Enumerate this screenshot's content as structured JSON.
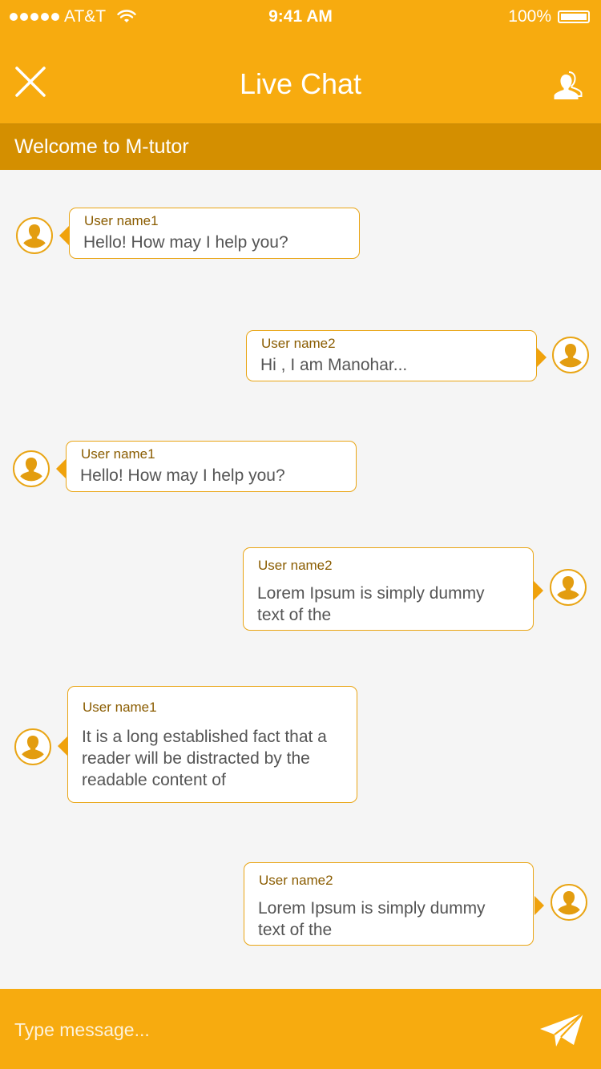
{
  "status_bar": {
    "carrier": "AT&T",
    "time": "9:41 AM",
    "battery": "100%",
    "icons": [
      "signal-dots-icon",
      "wifi-icon",
      "battery-icon"
    ]
  },
  "header": {
    "title": "Live Chat",
    "left_icon": "close-icon",
    "right_icon": "users-icon"
  },
  "welcome_banner": "Welcome to M-tutor",
  "messages": [
    {
      "user": "User name1",
      "text": "Hello! How may I help you?",
      "side": "left"
    },
    {
      "user": "User name2",
      "text": "Hi , I am Manohar...",
      "side": "right"
    },
    {
      "user": "User name1",
      "text": "Hello! How may I help you?",
      "side": "left"
    },
    {
      "user": "User name2",
      "text": "Lorem Ipsum is simply dummy text of the",
      "side": "right"
    },
    {
      "user": "User name1",
      "text": "It is a long established fact that a reader will be distracted by the readable content of",
      "side": "left"
    },
    {
      "user": "User name2",
      "text": "Lorem Ipsum is simply dummy text of the",
      "side": "right"
    }
  ],
  "input": {
    "placeholder": "Type message...",
    "value": "",
    "send_icon": "send-icon"
  },
  "colors": {
    "primary": "#f7ab0f",
    "banner": "#d48f00",
    "bubble_border": "#e9a515",
    "background": "#f5f5f5",
    "username": "#8a5c00",
    "message_text": "#555555"
  }
}
